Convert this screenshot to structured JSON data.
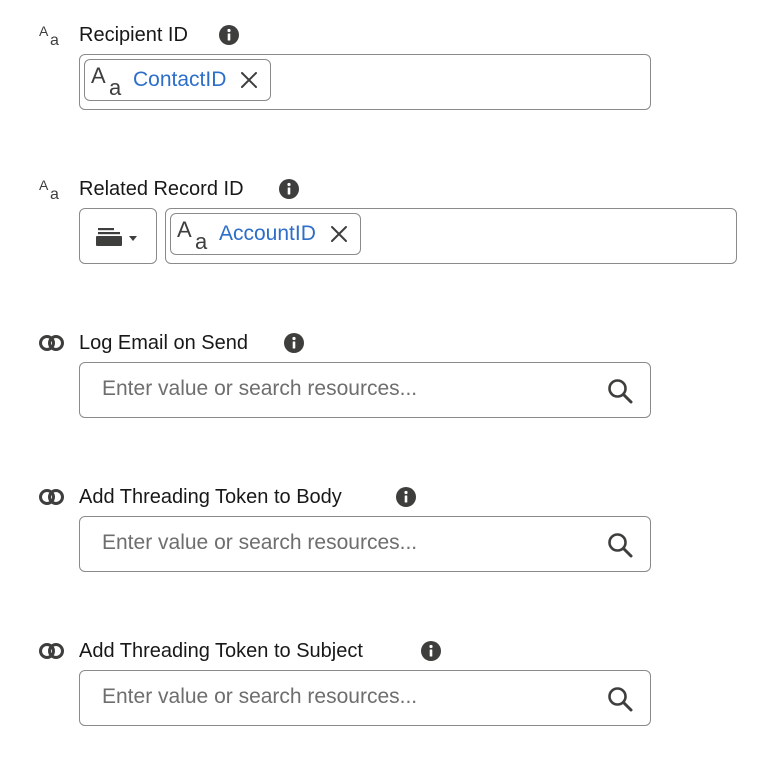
{
  "fields": [
    {
      "label": "Recipient ID",
      "type_icon": "text-type-icon",
      "value_pill": "ContactID"
    },
    {
      "label": "Related Record ID",
      "type_icon": "text-type-icon",
      "value_pill": "AccountID",
      "mode_icon": "resource-picker-icon"
    },
    {
      "label": "Log Email on Send",
      "type_icon": "boolean-type-icon",
      "placeholder": "Enter value or search resources..."
    },
    {
      "label": "Add Threading Token to Body",
      "type_icon": "boolean-type-icon",
      "placeholder": "Enter value or search resources..."
    },
    {
      "label": "Add Threading Token to Subject",
      "type_icon": "boolean-type-icon",
      "placeholder": "Enter value or search resources..."
    }
  ],
  "colors": {
    "link": "#2d6ec9",
    "border": "#8a8a8a",
    "icon": "#3e3e3c",
    "placeholder": "#6e6e6e"
  }
}
